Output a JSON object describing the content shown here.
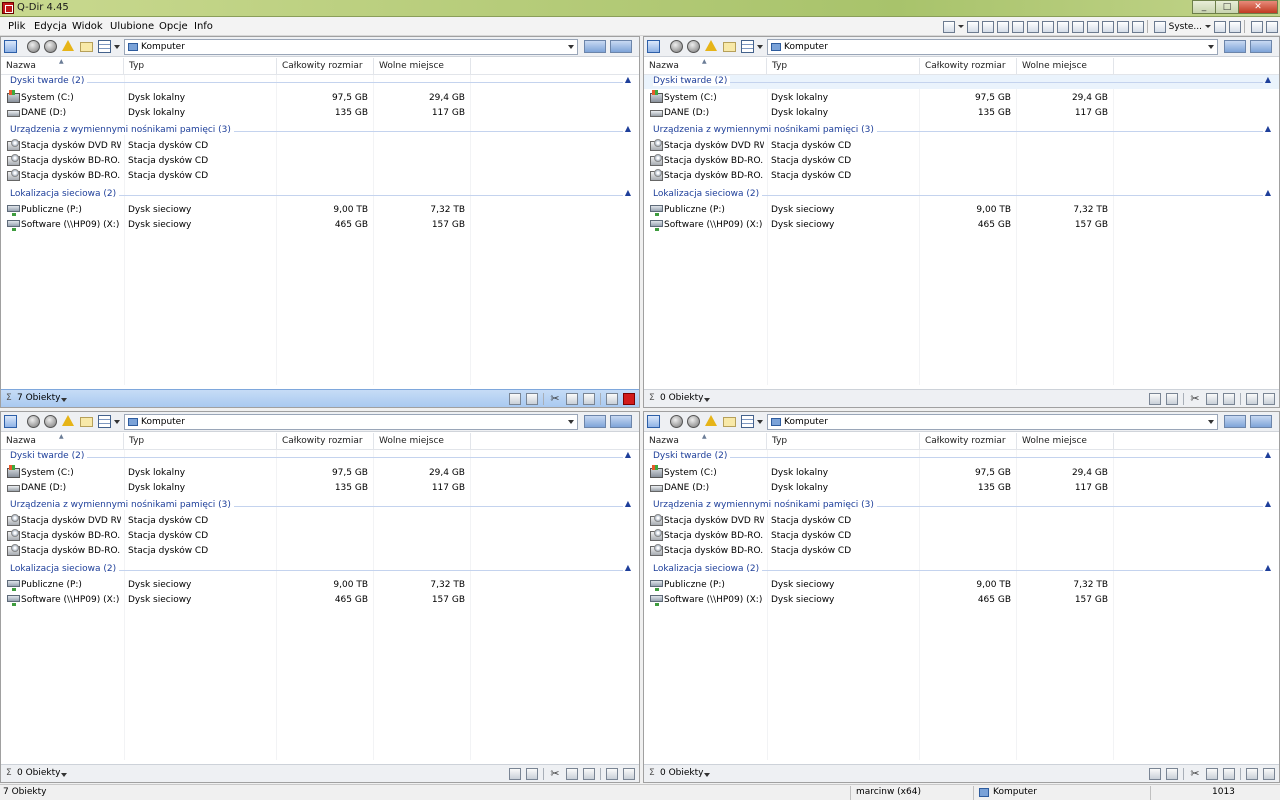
{
  "app": {
    "title": "Q-Dir 4.45",
    "menus": [
      "Plik",
      "Edycja",
      "Widok",
      "Ulubione",
      "Opcje",
      "Info"
    ],
    "toolbar_text": "Syste...",
    "colors": {
      "group": "#1e3f9a",
      "active_status": "#a9c9f0",
      "accent": "#c01818"
    }
  },
  "columns": [
    "Nazwa",
    "Typ",
    "Całkowity rozmiar",
    "Wolne miejsce"
  ],
  "address": "Komputer",
  "groups": [
    {
      "title": "Dyski twarde (2)"
    },
    {
      "title": "Urządzenia z wymiennymi nośnikami pamięci (3)"
    },
    {
      "title": "Lokalizacja sieciowa (2)"
    }
  ],
  "items": [
    {
      "name": "System (C:)",
      "type": "Dysk lokalny",
      "total": "97,5 GB",
      "free": "29,4 GB",
      "icon": "hdd-system-icon"
    },
    {
      "name": "DANE (D:)",
      "type": "Dysk lokalny",
      "total": "135 GB",
      "free": "117 GB",
      "icon": "hdd-icon"
    },
    {
      "name": "Stacja dysków DVD RW...",
      "type": "Stacja dysków CD",
      "total": "",
      "free": "",
      "icon": "cd-drive-icon"
    },
    {
      "name": "Stacja dysków BD-RO...",
      "type": "Stacja dysków CD",
      "total": "",
      "free": "",
      "icon": "cd-drive-icon"
    },
    {
      "name": "Stacja dysków BD-RO...",
      "type": "Stacja dysków CD",
      "total": "",
      "free": "",
      "icon": "cd-drive-icon"
    },
    {
      "name": "Publiczne (P:)",
      "type": "Dysk sieciowy",
      "total": "9,00 TB",
      "free": "7,32 TB",
      "icon": "network-drive-icon"
    },
    {
      "name": "Software (\\\\HP09) (X:)",
      "type": "Dysk sieciowy",
      "total": "465 GB",
      "free": "157 GB",
      "icon": "network-drive-icon"
    }
  ],
  "panes": [
    {
      "status": "7 Obiekty",
      "active": true
    },
    {
      "status": "0 Obiekty",
      "active": false
    },
    {
      "status": "0 Obiekty",
      "active": false
    },
    {
      "status": "0 Obiekty",
      "active": false
    }
  ],
  "statusbar": {
    "objects": "7 Obiekty",
    "user": "marcinw (x64)",
    "location": "Komputer",
    "number": "1013"
  }
}
